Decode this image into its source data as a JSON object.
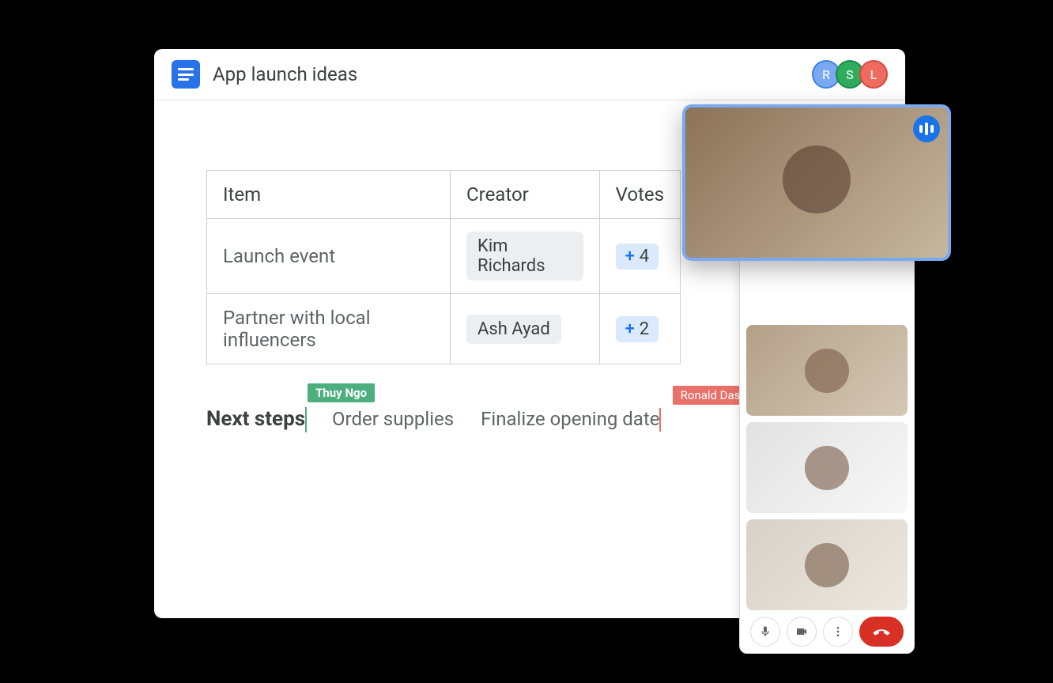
{
  "doc": {
    "title": "App launch ideas",
    "collaborators": [
      {
        "initial": "R",
        "color": "blue"
      },
      {
        "initial": "S",
        "color": "green"
      },
      {
        "initial": "L",
        "color": "red"
      }
    ]
  },
  "table": {
    "headers": {
      "item": "Item",
      "creator": "Creator",
      "votes": "Votes"
    },
    "rows": [
      {
        "item": "Launch event",
        "creator": "Kim Richards",
        "votes": 4
      },
      {
        "item": "Partner with local influencers",
        "creator": "Ash Ayad",
        "votes": 2
      }
    ]
  },
  "section_heading": "Next steps",
  "body_lines": [
    "Order supplies",
    "Finalize opening date"
  ],
  "cursors": {
    "green_user": "Thuy Ngo",
    "red_user": "Ronald Das"
  },
  "meet": {
    "participants_count": 4,
    "controls": {
      "mic": "microphone",
      "camera": "camera",
      "more": "more-options",
      "end": "end-call"
    }
  }
}
